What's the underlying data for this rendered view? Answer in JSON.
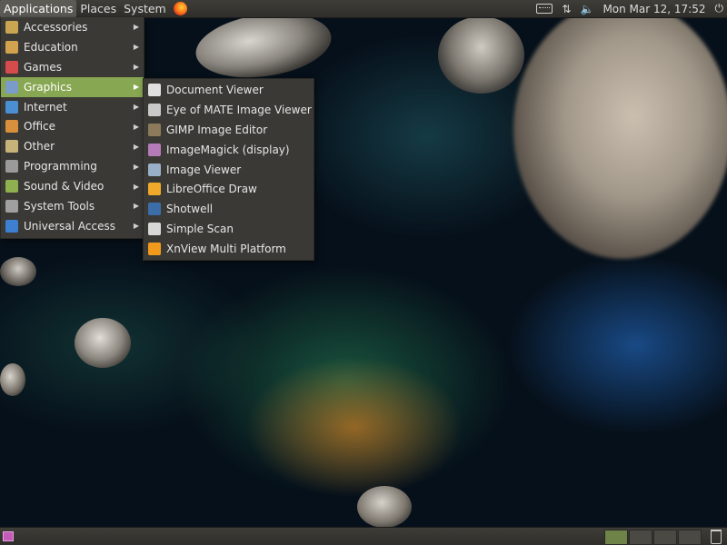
{
  "top_panel": {
    "menus": [
      "Applications",
      "Places",
      "System"
    ],
    "clock": "Mon Mar 12, 17:52",
    "icons": [
      "firefox-icon",
      "keyboard-icon",
      "network-icon",
      "volume-icon",
      "power-icon"
    ]
  },
  "app_menu": {
    "items": [
      {
        "label": "Accessories",
        "icon": "accessories-icon",
        "color": "#c9a451"
      },
      {
        "label": "Education",
        "icon": "education-icon",
        "color": "#d2a24e"
      },
      {
        "label": "Games",
        "icon": "games-icon",
        "color": "#d64b4b"
      },
      {
        "label": "Graphics",
        "icon": "graphics-icon",
        "color": "#7b9cc9"
      },
      {
        "label": "Internet",
        "icon": "internet-icon",
        "color": "#4a8fd1"
      },
      {
        "label": "Office",
        "icon": "office-icon",
        "color": "#d9903d"
      },
      {
        "label": "Other",
        "icon": "other-icon",
        "color": "#c7b37a"
      },
      {
        "label": "Programming",
        "icon": "programming-icon",
        "color": "#9a9a9a"
      },
      {
        "label": "Sound & Video",
        "icon": "sound-video-icon",
        "color": "#8fb04e"
      },
      {
        "label": "System Tools",
        "icon": "system-tools-icon",
        "color": "#a0a0a0"
      },
      {
        "label": "Universal Access",
        "icon": "universal-access-icon",
        "color": "#3d7fd1"
      }
    ],
    "active_index": 3,
    "active_color": "#87a752"
  },
  "submenu": {
    "items": [
      {
        "label": "Document Viewer",
        "icon": "document-viewer-icon",
        "color": "#e0e0e0"
      },
      {
        "label": "Eye of MATE Image Viewer",
        "icon": "eye-of-mate-icon",
        "color": "#c9c9c9"
      },
      {
        "label": "GIMP Image Editor",
        "icon": "gimp-icon",
        "color": "#8c7a5a"
      },
      {
        "label": "ImageMagick (display)",
        "icon": "imagemagick-icon",
        "color": "#b57ab8"
      },
      {
        "label": "Image Viewer",
        "icon": "image-viewer-icon",
        "color": "#9ab0c9"
      },
      {
        "label": "LibreOffice Draw",
        "icon": "libreoffice-draw-icon",
        "color": "#f0a92b"
      },
      {
        "label": "Shotwell",
        "icon": "shotwell-icon",
        "color": "#3b6ea8"
      },
      {
        "label": "Simple Scan",
        "icon": "simple-scan-icon",
        "color": "#d8d8d8"
      },
      {
        "label": "XnView Multi Platform",
        "icon": "xnview-icon",
        "color": "#f29a1c"
      }
    ]
  },
  "bottom_panel": {
    "icons": [
      "show-desktop-icon",
      "trash-icon"
    ],
    "workspace_count": 4,
    "active_workspace": 0
  }
}
